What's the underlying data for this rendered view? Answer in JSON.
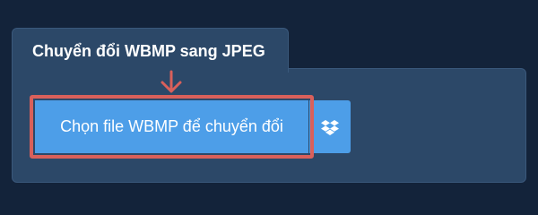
{
  "converter": {
    "tab_title": "Chuyển đổi WBMP sang JPEG",
    "convert_button_label": "Chọn file WBMP để chuyển đổi"
  },
  "icons": {
    "arrow": "arrow-down-icon",
    "dropbox": "dropbox-icon"
  },
  "colors": {
    "page_background": "#13233a",
    "panel_background": "#2c4868",
    "button_blue": "#4d9ee8",
    "highlight_red": "#d9605b"
  }
}
